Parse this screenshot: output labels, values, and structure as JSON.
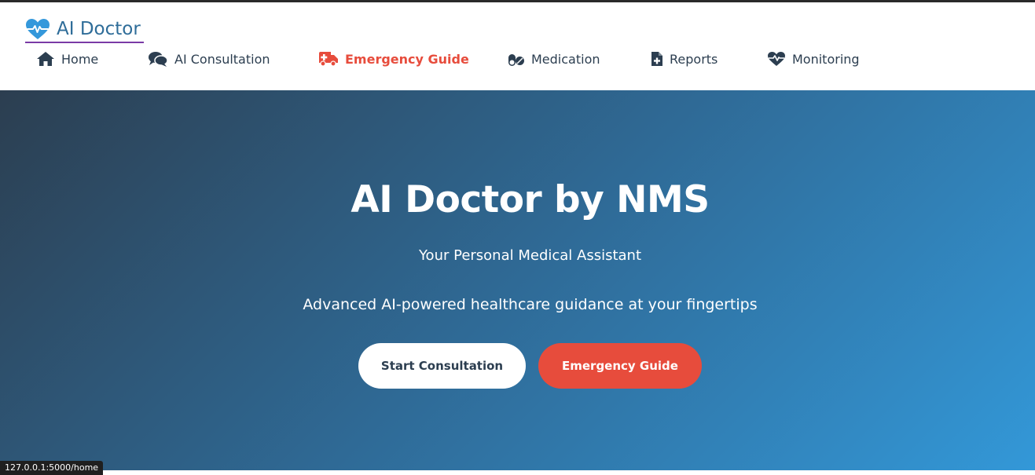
{
  "brand": {
    "name": "AI Doctor",
    "icon": "heart-pulse-icon",
    "color": "#2f6d99",
    "icon_color": "#3498db"
  },
  "nav": {
    "items": [
      {
        "label": "Home",
        "icon": "home-icon",
        "active": false
      },
      {
        "label": "AI Consultation",
        "icon": "comments-icon",
        "active": false
      },
      {
        "label": "Emergency Guide",
        "icon": "ambulance-icon",
        "active": true
      },
      {
        "label": "Medication",
        "icon": "pills-icon",
        "active": false
      },
      {
        "label": "Reports",
        "icon": "file-medical-icon",
        "active": false
      },
      {
        "label": "Monitoring",
        "icon": "heartbeat-icon",
        "active": false
      }
    ],
    "text_color": "#2c3e50",
    "active_color": "#e74c3c"
  },
  "hero": {
    "title": "AI Doctor by NMS",
    "subtitle": "Your Personal Medical Assistant",
    "description": "Advanced AI-powered healthcare guidance at your fingertips",
    "gradient": [
      "#2c3e50",
      "#3398d8"
    ],
    "buttons": {
      "start_label": "Start Consultation",
      "emergency_label": "Emergency Guide",
      "emergency_color": "#e74c3c"
    }
  },
  "status_bar": {
    "url": "127.0.0.1:5000/home"
  }
}
